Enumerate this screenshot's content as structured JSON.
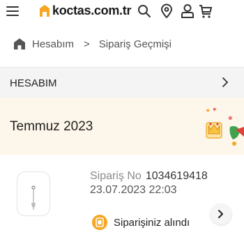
{
  "header": {
    "logo_text": "koctas.com.tr",
    "menu_icon": "hamburger-menu-icon",
    "icons": [
      "search-icon",
      "location-pin-icon",
      "user-icon",
      "cart-icon"
    ]
  },
  "breadcrumb": {
    "home_icon": "home-icon",
    "items": [
      "Hesabım",
      "Sipariş Geçmişi"
    ],
    "separator": ">"
  },
  "account": {
    "title": "HESABIM",
    "chevron": ">"
  },
  "month": {
    "title": "Temmuz 2023"
  },
  "order": {
    "number_label": "Sipariş No",
    "number": "1034619418",
    "date": "23.07.2023 22:03",
    "status": "Siparişiniz alındı",
    "status_icon": "order-received-icon",
    "arrow_icon": "chevron-right-icon"
  },
  "colors": {
    "brand": "#f6a623",
    "banner_bg": "#fdf6ea",
    "row_bg": "#f4f4f4"
  }
}
